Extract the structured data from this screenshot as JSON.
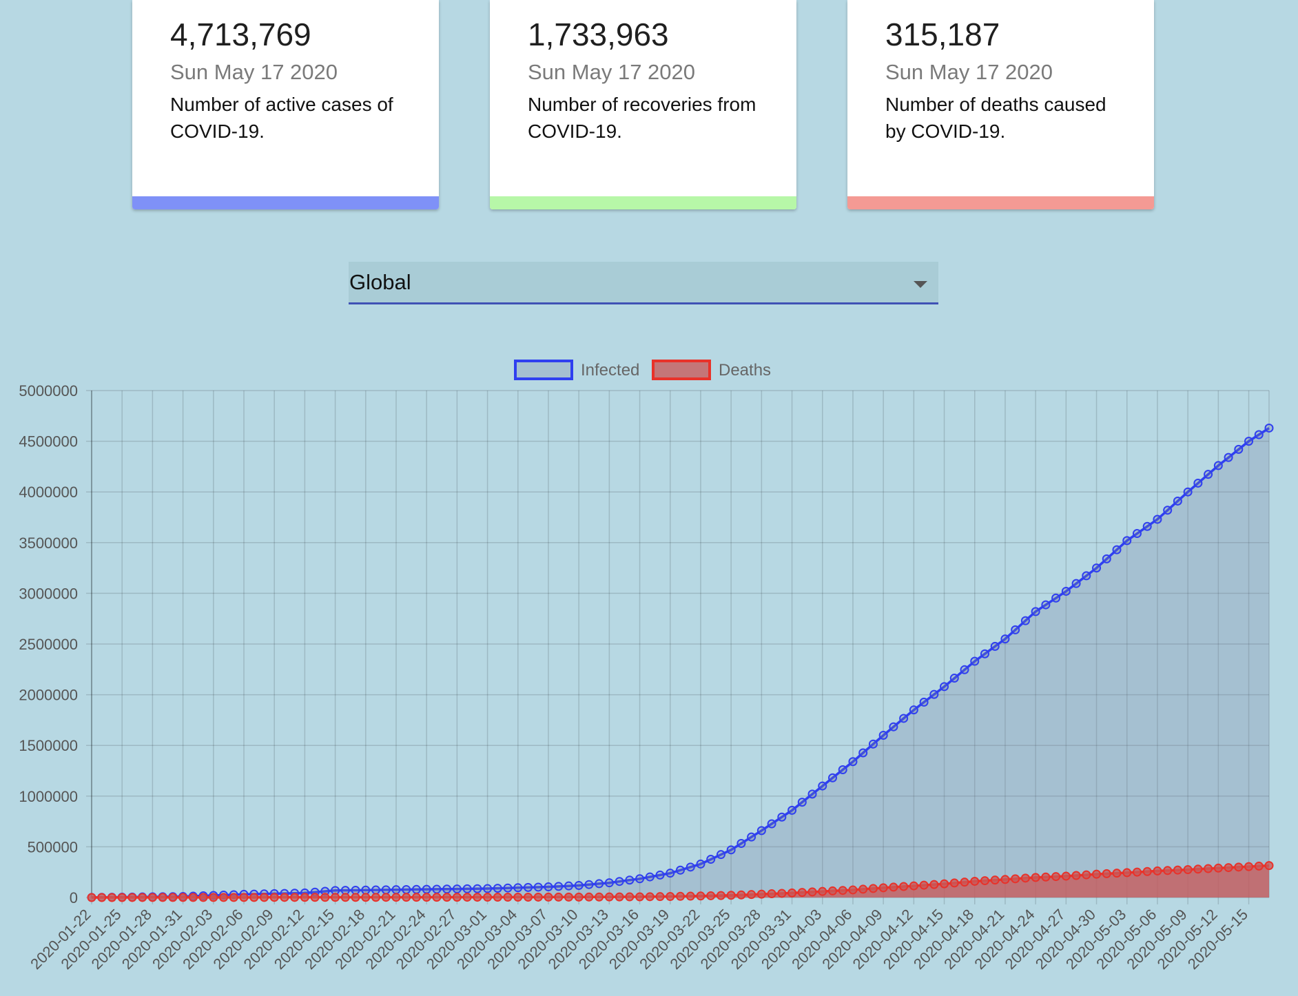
{
  "cards": [
    {
      "value": "4,713,769",
      "date": "Sun May 17 2020",
      "desc": "Number of active cases of COVID-19.",
      "color": "#7f91f7"
    },
    {
      "value": "1,733,963",
      "date": "Sun May 17 2020",
      "desc": "Number of recoveries from COVID-19.",
      "color": "#b7f7a8"
    },
    {
      "value": "315,187",
      "date": "Sun May 17 2020",
      "desc": "Number of deaths caused by COVID-19.",
      "color": "#f49a94"
    }
  ],
  "region_select": {
    "value": "Global"
  },
  "chart_data": {
    "type": "line",
    "legend_position": "top",
    "grid": true,
    "ylim": [
      0,
      5000000
    ],
    "yticks": [
      0,
      500000,
      1000000,
      1500000,
      2000000,
      2500000,
      3000000,
      3500000,
      4000000,
      4500000,
      5000000
    ],
    "x_start": "2020-01-22",
    "x_end": "2020-05-17",
    "x_tick_labels": [
      "2020-01-22",
      "2020-01-25",
      "2020-01-28",
      "2020-01-31",
      "2020-02-03",
      "2020-02-06",
      "2020-02-09",
      "2020-02-12",
      "2020-02-15",
      "2020-02-18",
      "2020-02-21",
      "2020-02-24",
      "2020-02-27",
      "2020-03-01",
      "2020-03-04",
      "2020-03-07",
      "2020-03-10",
      "2020-03-13",
      "2020-03-16",
      "2020-03-19",
      "2020-03-22",
      "2020-03-25",
      "2020-03-28",
      "2020-03-31",
      "2020-04-03",
      "2020-04-06",
      "2020-04-09",
      "2020-04-12",
      "2020-04-15",
      "2020-04-18",
      "2020-04-21",
      "2020-04-24",
      "2020-04-27",
      "2020-04-30",
      "2020-05-03",
      "2020-05-06",
      "2020-05-09",
      "2020-05-12",
      "2020-05-15"
    ],
    "series": [
      {
        "name": "Infected",
        "color": "#2f3ff0",
        "fill": "rgba(120,130,160,0.28)",
        "anchors": [
          [
            "2020-01-22",
            555
          ],
          [
            "2020-01-31",
            9800
          ],
          [
            "2020-02-06",
            31000
          ],
          [
            "2020-02-12",
            45000
          ],
          [
            "2020-02-15",
            69000
          ],
          [
            "2020-02-21",
            77000
          ],
          [
            "2020-03-01",
            88000
          ],
          [
            "2020-03-07",
            105000
          ],
          [
            "2020-03-10",
            119000
          ],
          [
            "2020-03-13",
            145000
          ],
          [
            "2020-03-16",
            185000
          ],
          [
            "2020-03-19",
            240000
          ],
          [
            "2020-03-22",
            330000
          ],
          [
            "2020-03-25",
            470000
          ],
          [
            "2020-03-28",
            660000
          ],
          [
            "2020-03-31",
            860000
          ],
          [
            "2020-04-03",
            1100000
          ],
          [
            "2020-04-06",
            1340000
          ],
          [
            "2020-04-09",
            1600000
          ],
          [
            "2020-04-12",
            1850000
          ],
          [
            "2020-04-15",
            2080000
          ],
          [
            "2020-04-18",
            2330000
          ],
          [
            "2020-04-21",
            2550000
          ],
          [
            "2020-04-24",
            2820000
          ],
          [
            "2020-04-27",
            3020000
          ],
          [
            "2020-04-30",
            3250000
          ],
          [
            "2020-05-03",
            3520000
          ],
          [
            "2020-05-06",
            3730000
          ],
          [
            "2020-05-09",
            4000000
          ],
          [
            "2020-05-12",
            4260000
          ],
          [
            "2020-05-15",
            4500000
          ],
          [
            "2020-05-17",
            4630000
          ]
        ]
      },
      {
        "name": "Deaths",
        "color": "#e8322a",
        "fill": "rgba(200,90,90,0.78)",
        "anchors": [
          [
            "2020-01-22",
            17
          ],
          [
            "2020-02-15",
            1500
          ],
          [
            "2020-03-01",
            3000
          ],
          [
            "2020-03-10",
            4300
          ],
          [
            "2020-03-16",
            7000
          ],
          [
            "2020-03-19",
            10000
          ],
          [
            "2020-03-22",
            15000
          ],
          [
            "2020-03-25",
            22000
          ],
          [
            "2020-03-28",
            33000
          ],
          [
            "2020-03-31",
            45000
          ],
          [
            "2020-04-03",
            60000
          ],
          [
            "2020-04-06",
            75000
          ],
          [
            "2020-04-09",
            96000
          ],
          [
            "2020-04-12",
            115000
          ],
          [
            "2020-04-15",
            135000
          ],
          [
            "2020-04-18",
            160000
          ],
          [
            "2020-04-21",
            178000
          ],
          [
            "2020-04-24",
            198000
          ],
          [
            "2020-04-27",
            211000
          ],
          [
            "2020-04-30",
            230000
          ],
          [
            "2020-05-03",
            245000
          ],
          [
            "2020-05-06",
            262000
          ],
          [
            "2020-05-09",
            275000
          ],
          [
            "2020-05-12",
            290000
          ],
          [
            "2020-05-15",
            305000
          ],
          [
            "2020-05-17",
            315000
          ]
        ]
      }
    ]
  }
}
